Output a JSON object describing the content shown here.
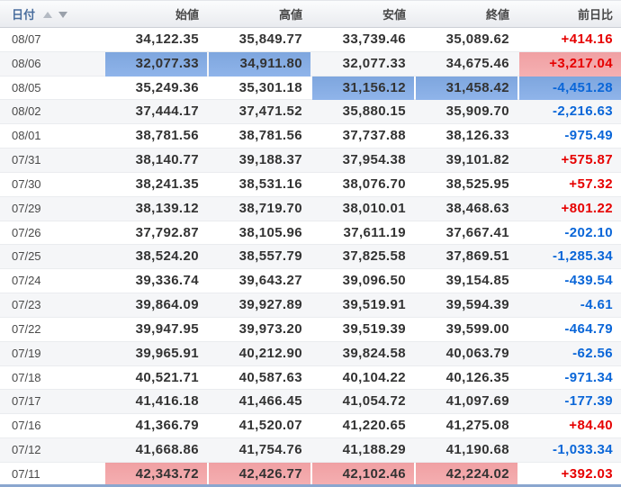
{
  "table": {
    "columns": [
      {
        "key": "date",
        "label": "日付"
      },
      {
        "key": "open",
        "label": "始値"
      },
      {
        "key": "high",
        "label": "高値"
      },
      {
        "key": "low",
        "label": "安値"
      },
      {
        "key": "close",
        "label": "終値"
      },
      {
        "key": "change",
        "label": "前日比"
      }
    ],
    "sort_icons": {
      "ascending": "triangle-up",
      "descending": "triangle-down"
    },
    "rows": [
      {
        "date": "08/07",
        "open": "34,122.35",
        "high": "35,849.77",
        "low": "33,739.46",
        "close": "35,089.62",
        "change": "+414.16",
        "change_dir": "up",
        "hl": {}
      },
      {
        "date": "08/06",
        "open": "32,077.33",
        "high": "34,911.80",
        "low": "32,077.33",
        "close": "34,675.46",
        "change": "+3,217.04",
        "change_dir": "up",
        "hl": {
          "open": "min",
          "high": "min",
          "change": "max"
        }
      },
      {
        "date": "08/05",
        "open": "35,249.36",
        "high": "35,301.18",
        "low": "31,156.12",
        "close": "31,458.42",
        "change": "-4,451.28",
        "change_dir": "down",
        "hl": {
          "low": "min",
          "close": "min",
          "change": "min"
        }
      },
      {
        "date": "08/02",
        "open": "37,444.17",
        "high": "37,471.52",
        "low": "35,880.15",
        "close": "35,909.70",
        "change": "-2,216.63",
        "change_dir": "down",
        "hl": {}
      },
      {
        "date": "08/01",
        "open": "38,781.56",
        "high": "38,781.56",
        "low": "37,737.88",
        "close": "38,126.33",
        "change": "-975.49",
        "change_dir": "down",
        "hl": {}
      },
      {
        "date": "07/31",
        "open": "38,140.77",
        "high": "39,188.37",
        "low": "37,954.38",
        "close": "39,101.82",
        "change": "+575.87",
        "change_dir": "up",
        "hl": {}
      },
      {
        "date": "07/30",
        "open": "38,241.35",
        "high": "38,531.16",
        "low": "38,076.70",
        "close": "38,525.95",
        "change": "+57.32",
        "change_dir": "up",
        "hl": {}
      },
      {
        "date": "07/29",
        "open": "38,139.12",
        "high": "38,719.70",
        "low": "38,010.01",
        "close": "38,468.63",
        "change": "+801.22",
        "change_dir": "up",
        "hl": {}
      },
      {
        "date": "07/26",
        "open": "37,792.87",
        "high": "38,105.96",
        "low": "37,611.19",
        "close": "37,667.41",
        "change": "-202.10",
        "change_dir": "down",
        "hl": {}
      },
      {
        "date": "07/25",
        "open": "38,524.20",
        "high": "38,557.79",
        "low": "37,825.58",
        "close": "37,869.51",
        "change": "-1,285.34",
        "change_dir": "down",
        "hl": {}
      },
      {
        "date": "07/24",
        "open": "39,336.74",
        "high": "39,643.27",
        "low": "39,096.50",
        "close": "39,154.85",
        "change": "-439.54",
        "change_dir": "down",
        "hl": {}
      },
      {
        "date": "07/23",
        "open": "39,864.09",
        "high": "39,927.89",
        "low": "39,519.91",
        "close": "39,594.39",
        "change": "-4.61",
        "change_dir": "down",
        "hl": {}
      },
      {
        "date": "07/22",
        "open": "39,947.95",
        "high": "39,973.20",
        "low": "39,519.39",
        "close": "39,599.00",
        "change": "-464.79",
        "change_dir": "down",
        "hl": {}
      },
      {
        "date": "07/19",
        "open": "39,965.91",
        "high": "40,212.90",
        "low": "39,824.58",
        "close": "40,063.79",
        "change": "-62.56",
        "change_dir": "down",
        "hl": {}
      },
      {
        "date": "07/18",
        "open": "40,521.71",
        "high": "40,587.63",
        "low": "40,104.22",
        "close": "40,126.35",
        "change": "-971.34",
        "change_dir": "down",
        "hl": {}
      },
      {
        "date": "07/17",
        "open": "41,416.18",
        "high": "41,466.45",
        "low": "41,054.72",
        "close": "41,097.69",
        "change": "-177.39",
        "change_dir": "down",
        "hl": {}
      },
      {
        "date": "07/16",
        "open": "41,366.79",
        "high": "41,520.07",
        "low": "41,220.65",
        "close": "41,275.08",
        "change": "+84.40",
        "change_dir": "up",
        "hl": {}
      },
      {
        "date": "07/12",
        "open": "41,668.86",
        "high": "41,754.76",
        "low": "41,188.29",
        "close": "41,190.68",
        "change": "-1,033.34",
        "change_dir": "down",
        "hl": {}
      },
      {
        "date": "07/11",
        "open": "42,343.72",
        "high": "42,426.77",
        "low": "42,102.46",
        "close": "42,224.02",
        "change": "+392.03",
        "change_dir": "up",
        "hl": {
          "open": "max",
          "high": "max",
          "low": "max",
          "close": "max"
        }
      }
    ]
  },
  "colors": {
    "positive_text": "#e60000",
    "negative_text": "#0a66d8",
    "max_highlight_bg": "#f2a8aa",
    "min_highlight_bg": "#86ade3",
    "date_header_text": "#4a6e9e",
    "row_stripe_bg": "#f5f6f8",
    "bottom_border": "#8aa6cf"
  }
}
